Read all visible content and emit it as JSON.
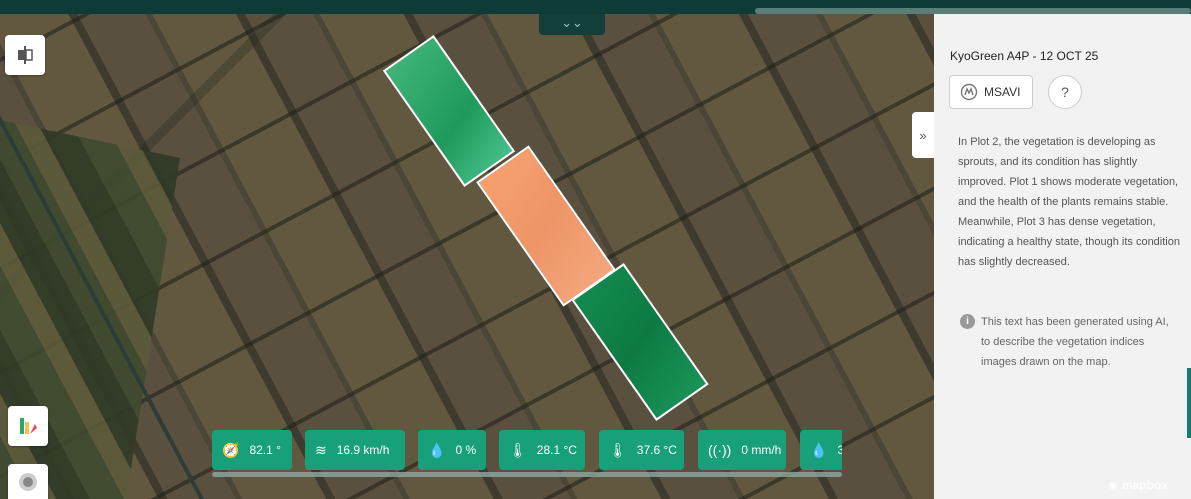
{
  "panel": {
    "title": "KyoGreen A4P - 12 OCT 25",
    "index_button": "MSAVI",
    "help_label": "?",
    "description": "In Plot 2, the vegetation is developing as sprouts, and its condition has slightly improved. Plot 1 shows moderate vegetation, and the health of the plants remains stable. Meanwhile, Plot 3 has dense vegetation, indicating a healthy state, though its condition has slightly decreased.",
    "ai_note": "This text has been generated using AI, to describe the vegetation indices images drawn on the map."
  },
  "weather": [
    {
      "icon": "compass-icon",
      "glyph": "🧭",
      "value": "82.1 °"
    },
    {
      "icon": "wind-icon",
      "glyph": "≋",
      "value": "16.9 km/h"
    },
    {
      "icon": "droplet-icon",
      "glyph": "💧",
      "value": "0 %"
    },
    {
      "icon": "temp-min-icon",
      "glyph": "🌡",
      "value": "28.1 °C"
    },
    {
      "icon": "temp-max-icon",
      "glyph": "🌡",
      "value": "37.6 °C"
    },
    {
      "icon": "rain-sensor-icon",
      "glyph": "((·))",
      "value": "0 mm/h"
    },
    {
      "icon": "humidity-icon",
      "glyph": "💧",
      "value": "3"
    }
  ],
  "attribution": "mapbox",
  "colors": {
    "plot1": "#2aa86a",
    "plot2": "#f19a6c",
    "plot3": "#0f8048",
    "accent": "#18a07a",
    "topbar": "#0f3b36"
  }
}
